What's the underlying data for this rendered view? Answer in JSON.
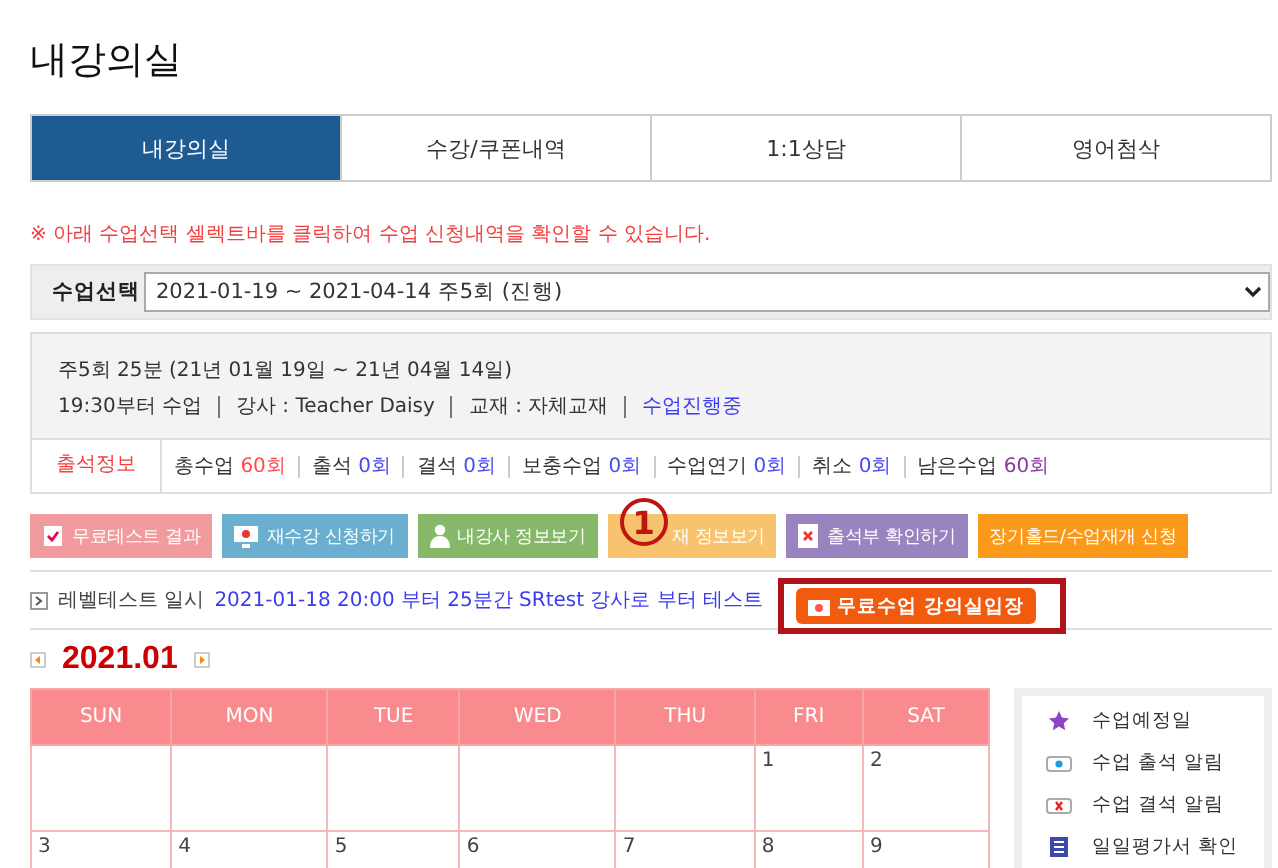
{
  "page_title": "내강의실",
  "tabs": [
    {
      "label": "내강의실",
      "selected": true
    },
    {
      "label": "수강/쿠폰내역",
      "selected": false
    },
    {
      "label": "1:1상담",
      "selected": false
    },
    {
      "label": "영어첨삭",
      "selected": false
    }
  ],
  "notice": "※ 아래 수업선택 셀렉트바를 클릭하여 수업 신청내역을 확인할 수 있습니다.",
  "course_select": {
    "label": "수업선택",
    "value": "2021-01-19 ~ 2021-04-14 주5회 (진행)"
  },
  "course_info": {
    "schedule": "주5회 25분 (21년 01월 19일 ~ 21년 04월 14일)",
    "details": [
      {
        "text": "19:30부터 수업",
        "kind": "plain"
      },
      {
        "text": "강사 : Teacher Daisy",
        "kind": "plain"
      },
      {
        "text": "교재 : 자체교재",
        "kind": "plain"
      },
      {
        "text": "수업진행중",
        "kind": "status"
      }
    ]
  },
  "attendance": {
    "label": "출석정보",
    "stats": [
      {
        "name": "총수업",
        "value": "60회",
        "color": "#ff4d4d"
      },
      {
        "name": "출석",
        "value": "0회",
        "color": "#4a4af0"
      },
      {
        "name": "결석",
        "value": "0회",
        "color": "#4a4af0"
      },
      {
        "name": "보충수업",
        "value": "0회",
        "color": "#4a4af0"
      },
      {
        "name": "수업연기",
        "value": "0회",
        "color": "#4a4af0"
      },
      {
        "name": "취소",
        "value": "0회",
        "color": "#4a4af0"
      },
      {
        "name": "남은수업",
        "value": "60회",
        "color": "#8a3a9a"
      }
    ]
  },
  "actions": [
    {
      "label": "무료테스트 결과",
      "color": "#f29b9e",
      "kind": "checklist"
    },
    {
      "label": "재수강 신청하기",
      "color": "#6aaed0",
      "kind": "monitor"
    },
    {
      "label": "내강사 정보보기",
      "color": "#86b86a",
      "kind": "person"
    },
    {
      "label": "재 정보보기",
      "color": "#f7c36e",
      "kind": "covered"
    },
    {
      "label": "출석부 확인하기",
      "color": "#9a84c0",
      "kind": "document"
    },
    {
      "label": "장기홀드/수업재개 신청",
      "color": "#fb9a1a",
      "kind": "none"
    }
  ],
  "annotation": {
    "marker": "1"
  },
  "level_test": {
    "label": "레벨테스트 일시",
    "text": "2021-01-18  20:00 부터 25분간 SRtest 강사로 부터 테스트",
    "button": "무료수업 강의실입장"
  },
  "calendar": {
    "month": "2021.01",
    "weekdays": [
      "SUN",
      "MON",
      "TUE",
      "WED",
      "THU",
      "FRI",
      "SAT"
    ],
    "weeks": [
      [
        {
          "kind": "blank"
        },
        {
          "kind": "blank"
        },
        {
          "kind": "blank"
        },
        {
          "kind": "blank"
        },
        {
          "kind": "blank"
        },
        {
          "kind": "day",
          "day": "1"
        },
        {
          "kind": "day",
          "day": "2"
        }
      ],
      [
        {
          "kind": "day",
          "day": "3"
        },
        {
          "kind": "day",
          "day": "4"
        },
        {
          "kind": "day",
          "day": "5"
        },
        {
          "kind": "day",
          "day": "6"
        },
        {
          "kind": "day",
          "day": "7"
        },
        {
          "kind": "day",
          "day": "8"
        },
        {
          "kind": "day",
          "day": "9"
        }
      ]
    ]
  },
  "legend": [
    {
      "label": "수업예정일",
      "kind": "star"
    },
    {
      "label": "수업 출석 알림",
      "kind": "eye"
    },
    {
      "label": "수업 결석 알림",
      "kind": "cross"
    },
    {
      "label": "일일평가서 확인",
      "kind": "sheet"
    }
  ]
}
